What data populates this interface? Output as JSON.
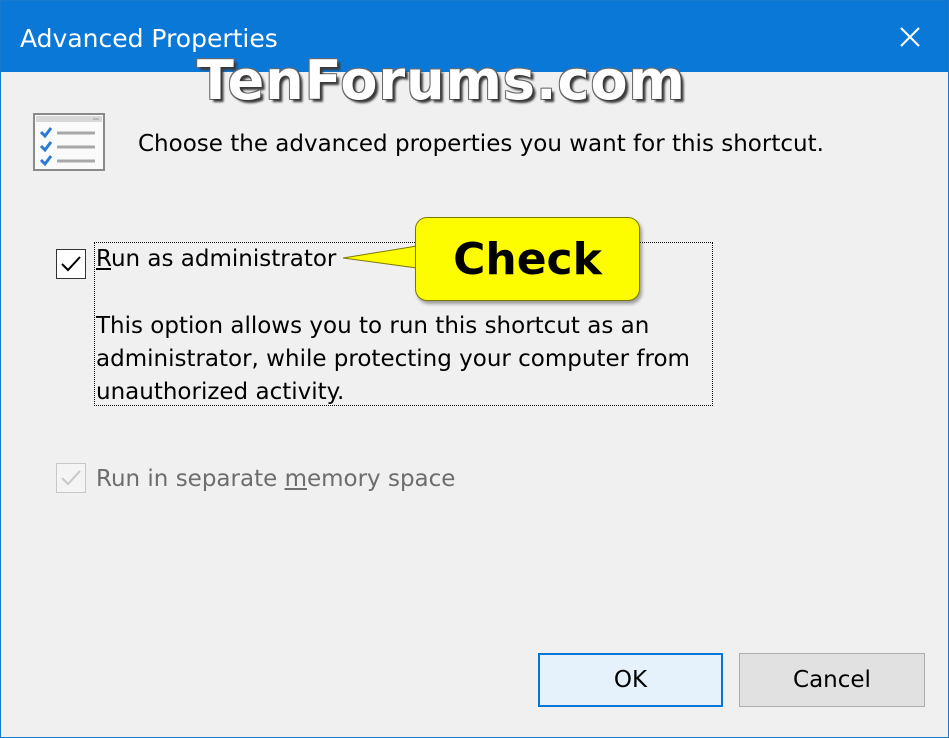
{
  "window": {
    "title": "Advanced Properties",
    "close_icon": "close-icon",
    "accent_color": "#0a78d7"
  },
  "watermark": "TenForums.com",
  "header": {
    "icon": "checklist-icon",
    "text": "Choose the advanced properties you want for this shortcut."
  },
  "options": {
    "run_as_admin": {
      "label_key": "R",
      "label_rest": "un as administrator",
      "checked": true,
      "description": "This option allows you to run this shortcut as an administrator, while protecting your computer from unauthorized activity."
    },
    "separate_memory": {
      "label_before": "Run in separate ",
      "label_key": "m",
      "label_after": "emory space",
      "checked": true,
      "disabled": true
    }
  },
  "callout": {
    "text": "Check",
    "color": "#fdfd00"
  },
  "buttons": {
    "ok": "OK",
    "cancel": "Cancel"
  }
}
